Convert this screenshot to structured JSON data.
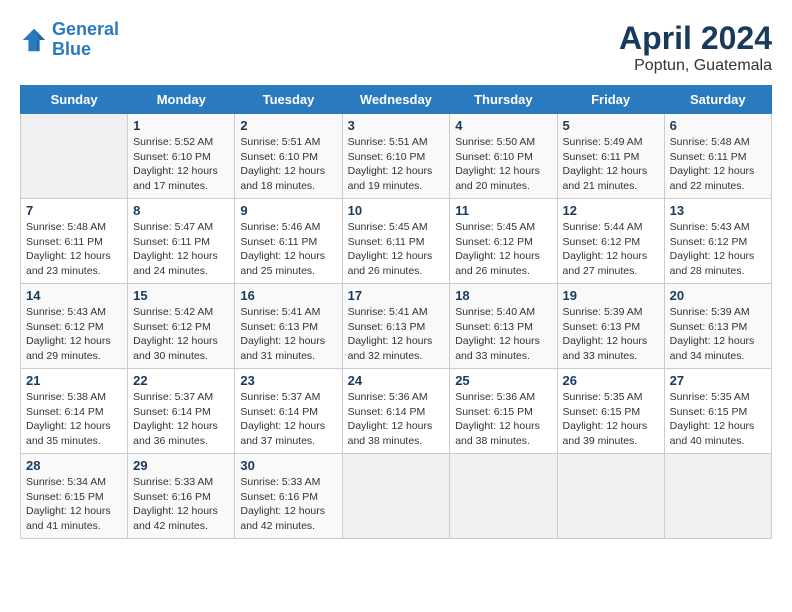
{
  "header": {
    "logo_line1": "General",
    "logo_line2": "Blue",
    "month": "April 2024",
    "location": "Poptun, Guatemala"
  },
  "days_of_week": [
    "Sunday",
    "Monday",
    "Tuesday",
    "Wednesday",
    "Thursday",
    "Friday",
    "Saturday"
  ],
  "weeks": [
    [
      {
        "day": "",
        "info": ""
      },
      {
        "day": "1",
        "info": "Sunrise: 5:52 AM\nSunset: 6:10 PM\nDaylight: 12 hours\nand 17 minutes."
      },
      {
        "day": "2",
        "info": "Sunrise: 5:51 AM\nSunset: 6:10 PM\nDaylight: 12 hours\nand 18 minutes."
      },
      {
        "day": "3",
        "info": "Sunrise: 5:51 AM\nSunset: 6:10 PM\nDaylight: 12 hours\nand 19 minutes."
      },
      {
        "day": "4",
        "info": "Sunrise: 5:50 AM\nSunset: 6:10 PM\nDaylight: 12 hours\nand 20 minutes."
      },
      {
        "day": "5",
        "info": "Sunrise: 5:49 AM\nSunset: 6:11 PM\nDaylight: 12 hours\nand 21 minutes."
      },
      {
        "day": "6",
        "info": "Sunrise: 5:48 AM\nSunset: 6:11 PM\nDaylight: 12 hours\nand 22 minutes."
      }
    ],
    [
      {
        "day": "7",
        "info": "Sunrise: 5:48 AM\nSunset: 6:11 PM\nDaylight: 12 hours\nand 23 minutes."
      },
      {
        "day": "8",
        "info": "Sunrise: 5:47 AM\nSunset: 6:11 PM\nDaylight: 12 hours\nand 24 minutes."
      },
      {
        "day": "9",
        "info": "Sunrise: 5:46 AM\nSunset: 6:11 PM\nDaylight: 12 hours\nand 25 minutes."
      },
      {
        "day": "10",
        "info": "Sunrise: 5:45 AM\nSunset: 6:11 PM\nDaylight: 12 hours\nand 26 minutes."
      },
      {
        "day": "11",
        "info": "Sunrise: 5:45 AM\nSunset: 6:12 PM\nDaylight: 12 hours\nand 26 minutes."
      },
      {
        "day": "12",
        "info": "Sunrise: 5:44 AM\nSunset: 6:12 PM\nDaylight: 12 hours\nand 27 minutes."
      },
      {
        "day": "13",
        "info": "Sunrise: 5:43 AM\nSunset: 6:12 PM\nDaylight: 12 hours\nand 28 minutes."
      }
    ],
    [
      {
        "day": "14",
        "info": "Sunrise: 5:43 AM\nSunset: 6:12 PM\nDaylight: 12 hours\nand 29 minutes."
      },
      {
        "day": "15",
        "info": "Sunrise: 5:42 AM\nSunset: 6:12 PM\nDaylight: 12 hours\nand 30 minutes."
      },
      {
        "day": "16",
        "info": "Sunrise: 5:41 AM\nSunset: 6:13 PM\nDaylight: 12 hours\nand 31 minutes."
      },
      {
        "day": "17",
        "info": "Sunrise: 5:41 AM\nSunset: 6:13 PM\nDaylight: 12 hours\nand 32 minutes."
      },
      {
        "day": "18",
        "info": "Sunrise: 5:40 AM\nSunset: 6:13 PM\nDaylight: 12 hours\nand 33 minutes."
      },
      {
        "day": "19",
        "info": "Sunrise: 5:39 AM\nSunset: 6:13 PM\nDaylight: 12 hours\nand 33 minutes."
      },
      {
        "day": "20",
        "info": "Sunrise: 5:39 AM\nSunset: 6:13 PM\nDaylight: 12 hours\nand 34 minutes."
      }
    ],
    [
      {
        "day": "21",
        "info": "Sunrise: 5:38 AM\nSunset: 6:14 PM\nDaylight: 12 hours\nand 35 minutes."
      },
      {
        "day": "22",
        "info": "Sunrise: 5:37 AM\nSunset: 6:14 PM\nDaylight: 12 hours\nand 36 minutes."
      },
      {
        "day": "23",
        "info": "Sunrise: 5:37 AM\nSunset: 6:14 PM\nDaylight: 12 hours\nand 37 minutes."
      },
      {
        "day": "24",
        "info": "Sunrise: 5:36 AM\nSunset: 6:14 PM\nDaylight: 12 hours\nand 38 minutes."
      },
      {
        "day": "25",
        "info": "Sunrise: 5:36 AM\nSunset: 6:15 PM\nDaylight: 12 hours\nand 38 minutes."
      },
      {
        "day": "26",
        "info": "Sunrise: 5:35 AM\nSunset: 6:15 PM\nDaylight: 12 hours\nand 39 minutes."
      },
      {
        "day": "27",
        "info": "Sunrise: 5:35 AM\nSunset: 6:15 PM\nDaylight: 12 hours\nand 40 minutes."
      }
    ],
    [
      {
        "day": "28",
        "info": "Sunrise: 5:34 AM\nSunset: 6:15 PM\nDaylight: 12 hours\nand 41 minutes."
      },
      {
        "day": "29",
        "info": "Sunrise: 5:33 AM\nSunset: 6:16 PM\nDaylight: 12 hours\nand 42 minutes."
      },
      {
        "day": "30",
        "info": "Sunrise: 5:33 AM\nSunset: 6:16 PM\nDaylight: 12 hours\nand 42 minutes."
      },
      {
        "day": "",
        "info": ""
      },
      {
        "day": "",
        "info": ""
      },
      {
        "day": "",
        "info": ""
      },
      {
        "day": "",
        "info": ""
      }
    ]
  ]
}
